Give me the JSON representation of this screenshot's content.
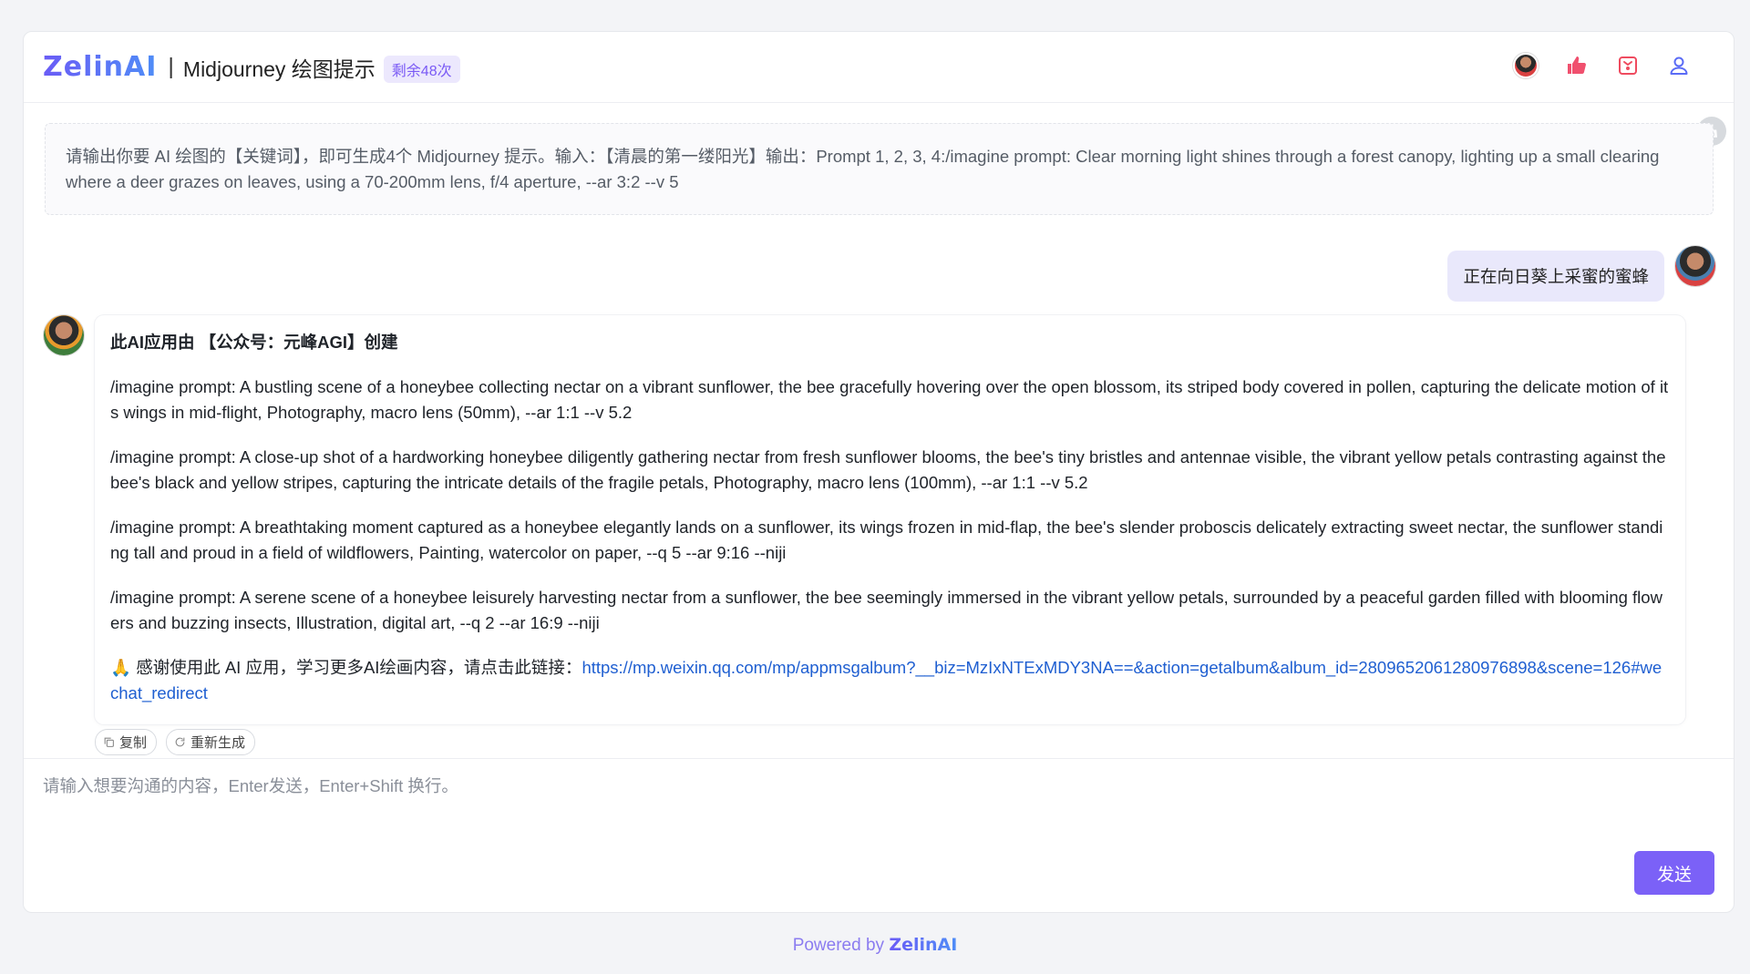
{
  "header": {
    "logo": "ZelinAI",
    "separator": "|",
    "title": "Midjourney 绘图提示",
    "quota_badge": "剩余48次",
    "icons": [
      "avatar",
      "thumbs-up-icon",
      "collection-icon",
      "user-icon"
    ]
  },
  "system_prompt": {
    "text": "请输出你要 AI 绘图的【关键词】，即可生成4个 Midjourney 提示。输入：【清晨的第一缕阳光】输出：Prompt 1, 2, 3, 4:/imagine prompt: Clear morning light shines through a forest canopy, lighting up a small clearing where a deer grazes on leaves, using a 70-200mm lens, f/4 aperture, --ar 3:2 --v 5"
  },
  "user_message": {
    "text": "正在向日葵上采蜜的蜜蜂"
  },
  "bot_message": {
    "heading": "此AI应用由 【公众号：元峰AGI】创建",
    "prompts": [
      "/imagine prompt: A bustling scene of a honeybee collecting nectar on a vibrant sunflower, the bee gracefully hovering over the open blossom, its striped body covered in pollen, capturing the delicate motion of its wings in mid-flight, Photography, macro lens (50mm), --ar 1:1 --v 5.2",
      "/imagine prompt: A close-up shot of a hardworking honeybee diligently gathering nectar from fresh sunflower blooms, the bee's tiny bristles and antennae visible, the vibrant yellow petals contrasting against the bee's black and yellow stripes, capturing the intricate details of the fragile petals, Photography, macro lens (100mm), --ar 1:1 --v 5.2",
      "/imagine prompt: A breathtaking moment captured as a honeybee elegantly lands on a sunflower, its wings frozen in mid-flap, the bee's slender proboscis delicately extracting sweet nectar, the sunflower standing tall and proud in a field of wildflowers, Painting, watercolor on paper, --q 5 --ar 9:16 --niji",
      "/imagine prompt: A serene scene of a honeybee leisurely harvesting nectar from a sunflower, the bee seemingly immersed in the vibrant yellow petals, surrounded by a peaceful garden filled with blooming flowers and buzzing insects, Illustration, digital art, --q 2 --ar 16:9 --niji"
    ],
    "thanks_emoji": "🙏",
    "thanks_text": "感谢使用此 AI 应用，学习更多AI绘画内容，请点击此链接：",
    "thanks_link": "https://mp.weixin.qq.com/mp/appmsgalbum?__biz=MzIxNTExMDY3NA==&action=getalbum&album_id=2809652061280976898&scene=126#wechat_redirect"
  },
  "actions": {
    "copy_label": "复制",
    "regenerate_label": "重新生成"
  },
  "input": {
    "placeholder": "请输入想要沟通的内容，Enter发送，Enter+Shift 换行。",
    "value": "",
    "send_label": "发送"
  },
  "footer": {
    "prefix": "Powered by ",
    "brand": "ZelinAI"
  },
  "colors": {
    "accent": "#7b61f7",
    "badge_bg": "#ece8fd",
    "user_bubble": "#e9e8fb",
    "link": "#1f5fd1"
  }
}
